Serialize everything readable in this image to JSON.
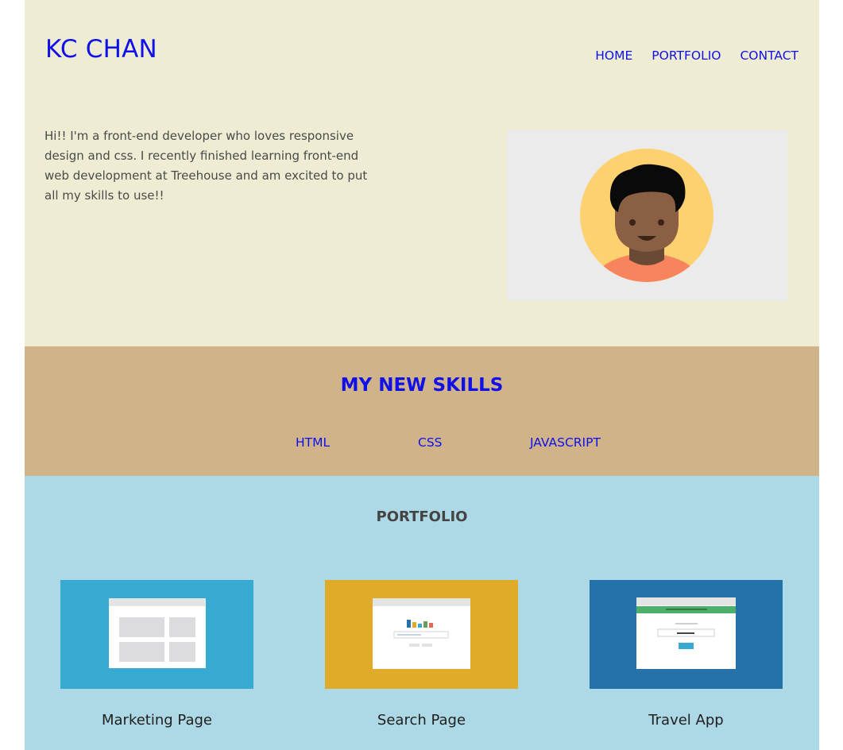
{
  "header": {
    "logo": "KC CHAN",
    "nav": [
      {
        "label": "HOME"
      },
      {
        "label": "PORTFOLIO"
      },
      {
        "label": "CONTACT"
      }
    ]
  },
  "intro": {
    "text": "Hi!! I'm a front-end developer who loves responsive design and css. I recently finished learning front-end web development at Treehouse and am excited to put all my skills to use!!"
  },
  "avatar": {
    "icon": "person-avatar-icon"
  },
  "skills": {
    "title": "MY NEW SKILLS",
    "items": [
      {
        "label": "HTML"
      },
      {
        "label": "CSS"
      },
      {
        "label": "JAVASCRIPT"
      }
    ]
  },
  "portfolio": {
    "title": "PORTFOLIO",
    "projects": [
      {
        "label": "Marketing Page",
        "color": "#36aad1"
      },
      {
        "label": "Search Page",
        "color": "#e0ab29"
      },
      {
        "label": "Travel App",
        "color": "#2571aa"
      }
    ]
  },
  "colors": {
    "link": "#1010e8",
    "hero_bg": "#efecd4",
    "skills_bg": "#d1b38a",
    "portfolio_bg": "#add8e5"
  }
}
